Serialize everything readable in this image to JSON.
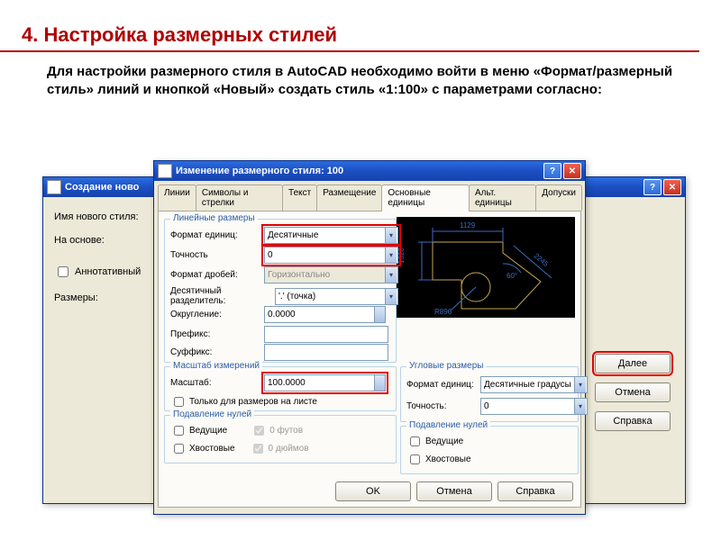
{
  "slide": {
    "title": "4. Настройка размерных стилей",
    "body": "Для настройки размерного стиля в AutoCAD необходимо войти в меню «Формат/размерный стиль» линий и кнопкой «Новый» создать стиль «1:100» с параметрами согласно:"
  },
  "backWindow": {
    "title": "Создание ново",
    "labels": {
      "newStyleName": "Имя нового стиля:",
      "basedOn": "На основе:",
      "annotative": "Аннотативный",
      "sizes": "Размеры:"
    },
    "buttons": {
      "next": "Далее",
      "cancel": "Отмена",
      "help": "Справка"
    }
  },
  "frontWindow": {
    "title": "Изменение размерного стиля: 100",
    "tabs": [
      "Линии",
      "Символы и стрелки",
      "Текст",
      "Размещение",
      "Основные единицы",
      "Альт. единицы",
      "Допуски"
    ],
    "activeTab": "Основные единицы",
    "linear": {
      "legend": "Линейные размеры",
      "unitFormat": {
        "label": "Формат единиц:",
        "value": "Десятичные"
      },
      "precision": {
        "label": "Точность",
        "value": "0"
      },
      "fractionFormat": {
        "label": "Формат дробей:",
        "value": "Горизонтально"
      },
      "decimalSeparator": {
        "label": "Десятичный разделитель:",
        "value": "'.' (точка)"
      },
      "rounding": {
        "label": "Округление:",
        "value": "0.0000"
      },
      "prefix": {
        "label": "Префикс:",
        "value": ""
      },
      "suffix": {
        "label": "Суффикс:",
        "value": ""
      }
    },
    "scale": {
      "legend": "Масштаб измерений",
      "scale": {
        "label": "Масштаб:",
        "value": "100.0000"
      },
      "layoutOnly": "Только для размеров на листе"
    },
    "zeroSuppressL": {
      "legend": "Подавление нулей",
      "leading": "Ведущие",
      "trailing": "Хвостовые",
      "feet": "0 футов",
      "inches": "0 дюймов"
    },
    "angular": {
      "legend": "Угловые размеры",
      "unitFormat": {
        "label": "Формат единиц:",
        "value": "Десятичные градусы"
      },
      "precision": {
        "label": "Точность:",
        "value": "0"
      }
    },
    "zeroSuppressA": {
      "legend": "Подавление нулей",
      "leading": "Ведущие",
      "trailing": "Хвостовые"
    },
    "preview": {
      "d1": "1129",
      "d2": "1328",
      "d3": "2245",
      "ang": "60°",
      "r": "R896"
    },
    "buttons": {
      "ok": "OK",
      "cancel": "Отмена",
      "help": "Справка"
    }
  }
}
